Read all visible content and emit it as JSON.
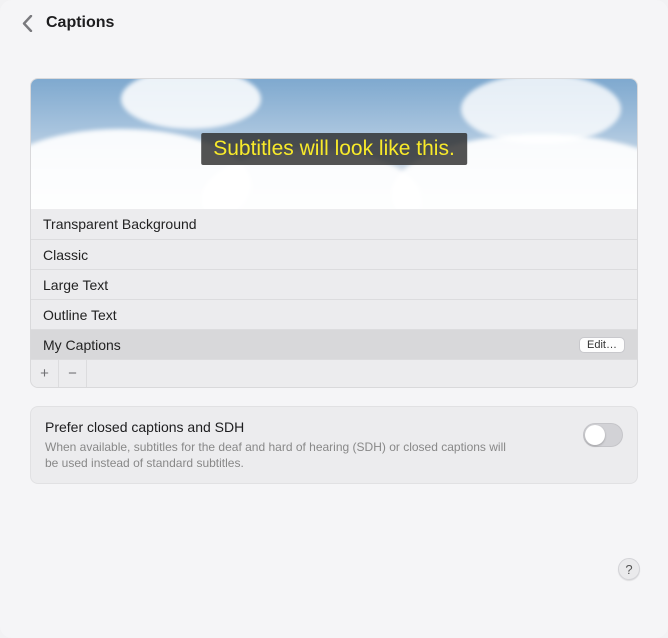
{
  "header": {
    "title": "Captions"
  },
  "preview": {
    "subtitle_text": "Subtitles will look like this."
  },
  "styles": [
    {
      "label": "Transparent Background",
      "selected": false,
      "editable": false
    },
    {
      "label": "Classic",
      "selected": false,
      "editable": false
    },
    {
      "label": "Large Text",
      "selected": false,
      "editable": false
    },
    {
      "label": "Outline Text",
      "selected": false,
      "editable": false
    },
    {
      "label": "My Captions",
      "selected": true,
      "editable": true
    }
  ],
  "edit_button_label": "Edit…",
  "footer": {
    "add": "+",
    "remove": "−"
  },
  "prefer": {
    "heading": "Prefer closed captions and SDH",
    "description": "When available, subtitles for the deaf and hard of hearing (SDH) or closed captions will be used instead of standard subtitles.",
    "enabled": false
  },
  "help_label": "?"
}
